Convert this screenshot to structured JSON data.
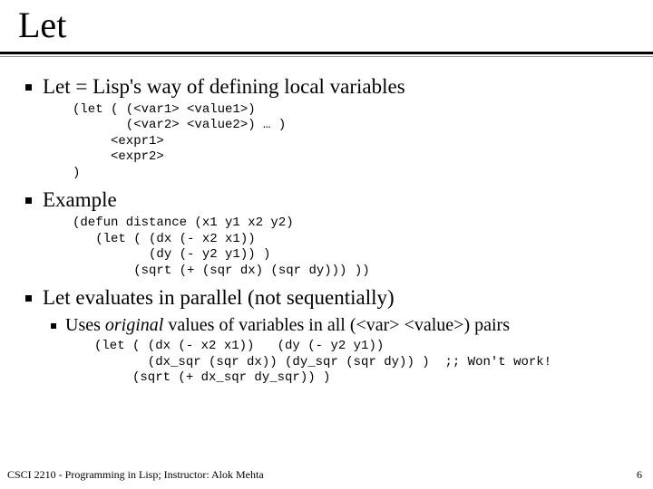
{
  "title": "Let",
  "bullets": {
    "b1": "Let = Lisp's way of defining local variables",
    "b2": "Example",
    "b3": "Let evaluates in parallel (not sequentially)",
    "sub1_pre": "Uses ",
    "sub1_ital": "original",
    "sub1_post": " values of variables in all (<var> <value>) pairs"
  },
  "code": {
    "c1": "(let ( (<var1> <value1>)\n       (<var2> <value2>) … )\n     <expr1>\n     <expr2>\n)",
    "c2": "(defun distance (x1 y1 x2 y2)\n   (let ( (dx (- x2 x1))\n          (dy (- y2 y1)) )\n        (sqrt (+ (sqr dx) (sqr dy))) ))",
    "c3": "(let ( (dx (- x2 x1))   (dy (- y2 y1))\n       (dx_sqr (sqr dx)) (dy_sqr (sqr dy)) )  ;; Won't work!\n     (sqrt (+ dx_sqr dy_sqr)) )"
  },
  "footer": {
    "left": "CSCI 2210 - Programming in Lisp; Instructor: Alok Mehta",
    "page": "6"
  }
}
